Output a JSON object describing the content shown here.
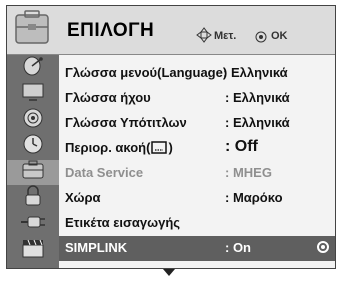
{
  "header": {
    "title": "ΕΠΙΛΟΓΗ",
    "move_hint": "Μετ.",
    "ok_hint": "OK"
  },
  "sidebar": {
    "items": [
      {
        "icon": "satellite-dish-icon"
      },
      {
        "icon": "tv-picture-icon"
      },
      {
        "icon": "speaker-audio-icon"
      },
      {
        "icon": "clock-icon"
      },
      {
        "icon": "option-toolbox-icon"
      },
      {
        "icon": "lock-icon"
      },
      {
        "icon": "input-plug-icon"
      },
      {
        "icon": "clapperboard-icon"
      }
    ]
  },
  "menu": {
    "rows": [
      {
        "label": "Γλώσσα μενού(Language)",
        "value": ": Ελληνικά"
      },
      {
        "label": "Γλώσσα ήχου",
        "value": ": Ελληνικά"
      },
      {
        "label": "Γλώσσα Υπότιτλων",
        "value": ": Ελληνικά"
      },
      {
        "label": "Περιορ. ακοή(",
        "value": ": Off"
      },
      {
        "label": "Data Service",
        "value": ": MHEG"
      },
      {
        "label": "Χώρα",
        "value": ": Μαρόκο"
      },
      {
        "label": "Ετικέτα εισαγωγής",
        "value": ""
      },
      {
        "label": "SIMPLINK",
        "value": ": On"
      }
    ]
  }
}
